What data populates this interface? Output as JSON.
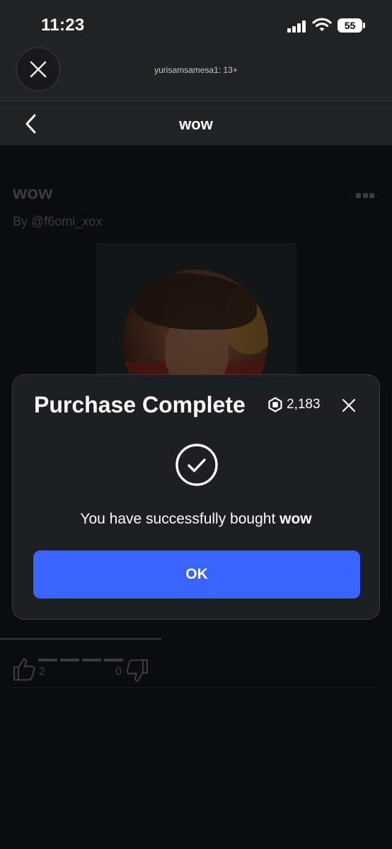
{
  "status_bar": {
    "time": "11:23",
    "battery": "55"
  },
  "header": {
    "subtitle": "yurisamsamesa1: 13+"
  },
  "nav": {
    "title": "wow"
  },
  "item": {
    "title": "wow",
    "creator": "By @f6omi_xox",
    "likes": "2",
    "dislikes": "0"
  },
  "modal": {
    "title": "Purchase Complete",
    "robux_balance": "2,183",
    "message_prefix": "You have successfully bought ",
    "item_name": "wow",
    "ok_label": "OK"
  },
  "colors": {
    "accent_button": "#3a63ff",
    "modal_bg": "#1e1f22",
    "header_bg": "#222325",
    "page_bg": "#0b0c0f"
  }
}
